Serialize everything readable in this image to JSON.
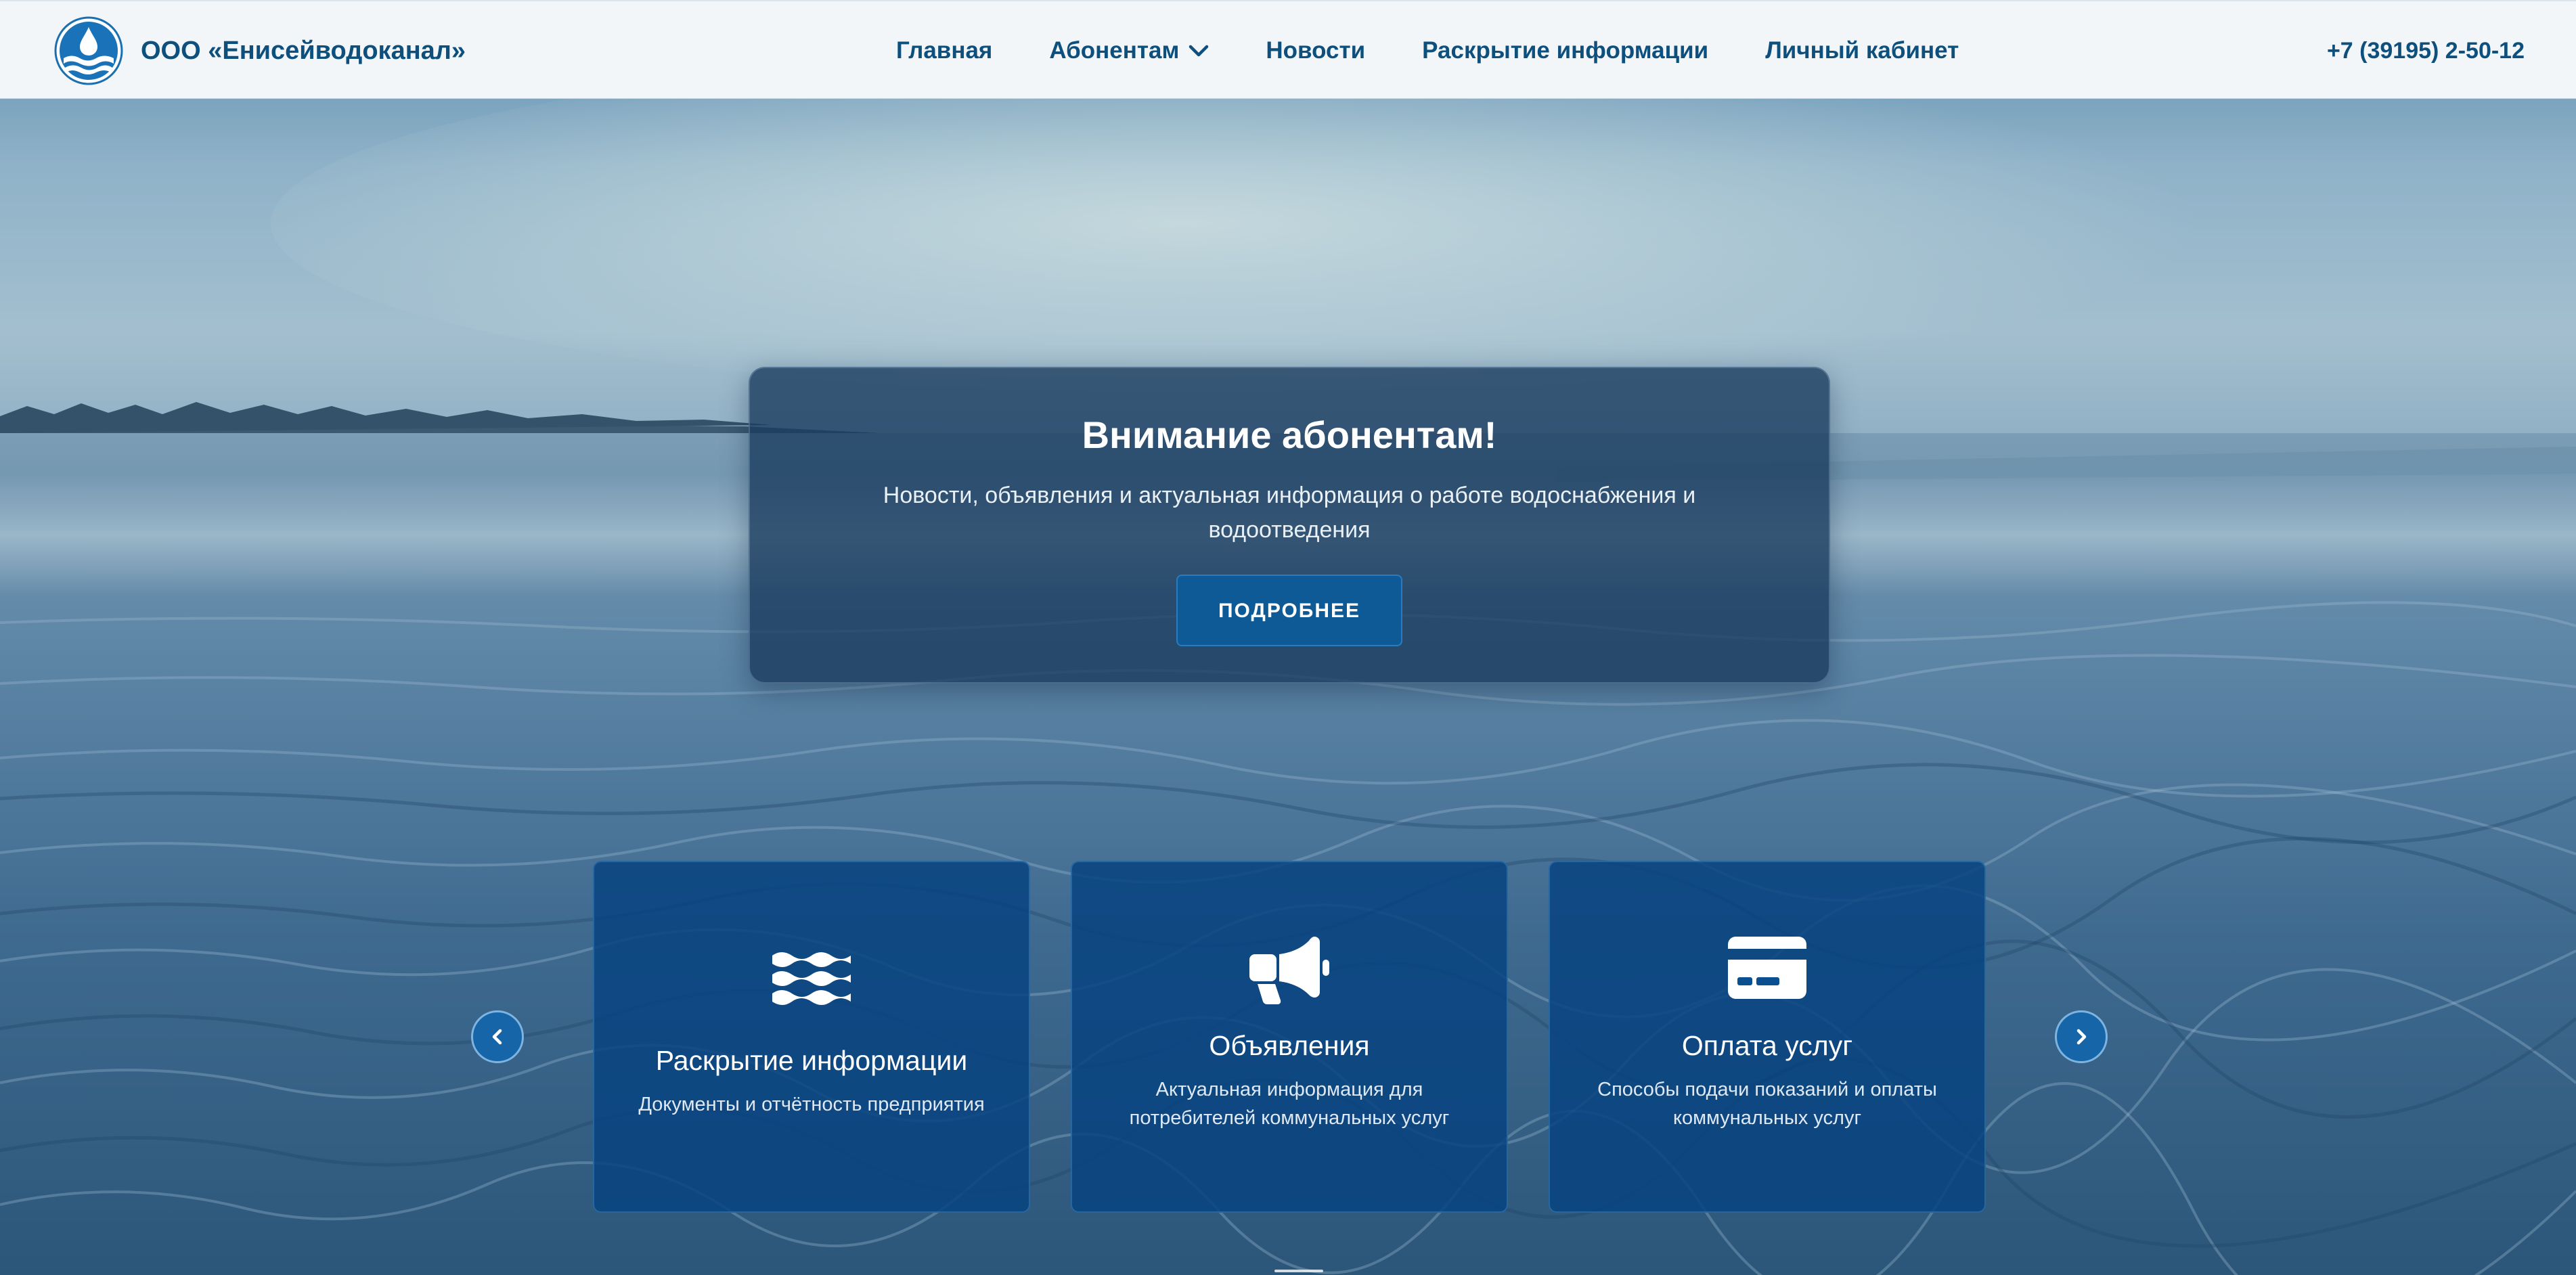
{
  "header": {
    "brand_name": "ООО «Енисейводоканал»",
    "nav": [
      {
        "label": "Главная"
      },
      {
        "label": "Абонентам"
      },
      {
        "label": "Новости"
      },
      {
        "label": "Раскрытие информации"
      },
      {
        "label": "Личный кабинет"
      }
    ],
    "phone": "+7 (39195) 2-50-12"
  },
  "notice": {
    "title": "Внимание абонентам!",
    "text": "Новости, объявления и актуальная информация о работе водоснабжения и водоотведения",
    "button_label": "ПОДРОБНЕЕ"
  },
  "cards": [
    {
      "icon": "water-waves-icon",
      "title": "Раскрытие информации",
      "description": "Документы и отчётность предприятия"
    },
    {
      "icon": "megaphone-icon",
      "title": "Объявления",
      "description": "Актуальная информация для потребителей коммунальных услуг"
    },
    {
      "icon": "credit-card-icon",
      "title": "Оплата услуг",
      "description": "Способы подачи показаний и оплаты коммунальных услуг"
    }
  ],
  "colors": {
    "brand_blue": "#0d4f7d",
    "header_bg": "#f3f6f9",
    "card_bg": "#084480",
    "button_bg": "#0e5a97"
  }
}
